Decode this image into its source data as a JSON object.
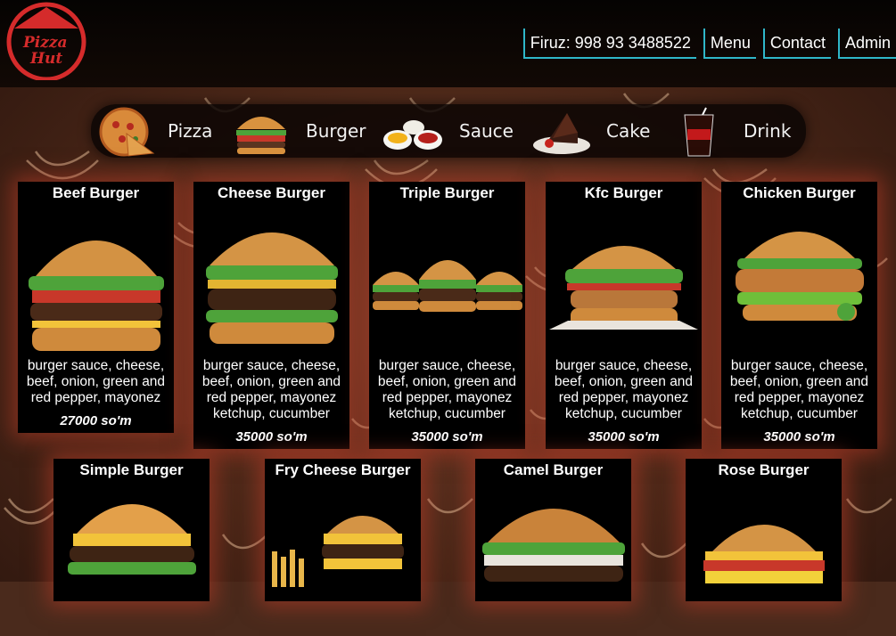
{
  "brand": {
    "logo_line1": "Pizza",
    "logo_line2": "Hut"
  },
  "nav": {
    "phone": "Firuz: 998 93 3488522",
    "menu": "Menu",
    "contact": "Contact",
    "admin": "Admin",
    "accent": "#2fb7c9"
  },
  "categories": [
    {
      "label": "Pizza",
      "icon": "pizza-icon"
    },
    {
      "label": "Burger",
      "icon": "burger-icon"
    },
    {
      "label": "Sauce",
      "icon": "sauce-icon"
    },
    {
      "label": "Cake",
      "icon": "cake-icon"
    },
    {
      "label": "Drink",
      "icon": "drink-icon"
    }
  ],
  "products": [
    {
      "title": "Beef Burger",
      "desc": "burger sauce, cheese, beef, onion, green and red pepper, mayonez",
      "price": "27000 so'm"
    },
    {
      "title": "Cheese Burger",
      "desc": "burger sauce, cheese, beef, onion, green and red pepper, mayonez ketchup, cucumber",
      "price": "35000 so'm"
    },
    {
      "title": "Triple Burger",
      "desc": "burger sauce, cheese, beef, onion, green and red pepper, mayonez ketchup, cucumber",
      "price": "35000 so'm"
    },
    {
      "title": "Kfc Burger",
      "desc": "burger sauce, cheese, beef, onion, green and red pepper, mayonez ketchup, cucumber",
      "price": "35000 so'm"
    },
    {
      "title": "Chicken Burger",
      "desc": "burger sauce, cheese, beef, onion, green and red pepper, mayonez ketchup, cucumber",
      "price": "35000 so'm"
    },
    {
      "title": "Simple Burger"
    },
    {
      "title": "Fry Cheese Burger"
    },
    {
      "title": "Camel Burger"
    },
    {
      "title": "Rose Burger"
    }
  ]
}
